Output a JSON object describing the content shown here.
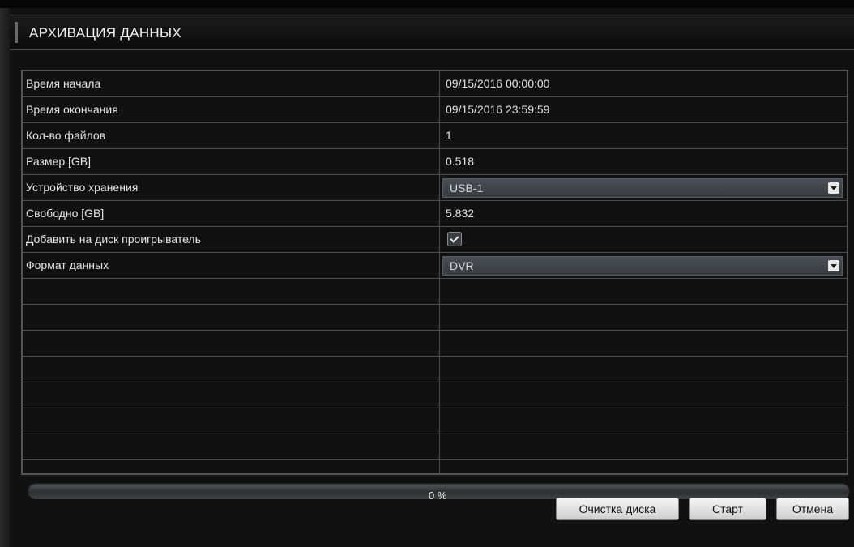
{
  "window": {
    "title": "АРХИВАЦИЯ ДАННЫХ"
  },
  "fields": {
    "start_time": {
      "label": "Время начала",
      "value": "09/15/2016 00:00:00"
    },
    "end_time": {
      "label": "Время окончания",
      "value": "09/15/2016 23:59:59"
    },
    "file_count": {
      "label": "Кол-во файлов",
      "value": "1"
    },
    "size": {
      "label": "Размер [GB]",
      "value": "0.518"
    },
    "storage_device": {
      "label": "Устройство хранения",
      "value": "USB-1"
    },
    "free": {
      "label": "Свободно [GB]",
      "value": "5.832"
    },
    "add_player": {
      "label": "Добавить на диск проигрыватель",
      "checked": true
    },
    "data_format": {
      "label": "Формат данных",
      "value": "DVR"
    }
  },
  "progress": {
    "percent_text": "0 %",
    "value": 0
  },
  "buttons": {
    "clear_disk": "Очистка диска",
    "start": "Старт",
    "cancel": "Отмена"
  },
  "icons": {
    "dropdown": "chevron-down-icon",
    "checkbox": "checkmark-icon"
  },
  "colors": {
    "background": "#111111",
    "grid_line": "#4b4b4b",
    "text": "#e6e6e6",
    "select_bg": "#3f4348",
    "progress_fill": "#7aa3d8"
  }
}
